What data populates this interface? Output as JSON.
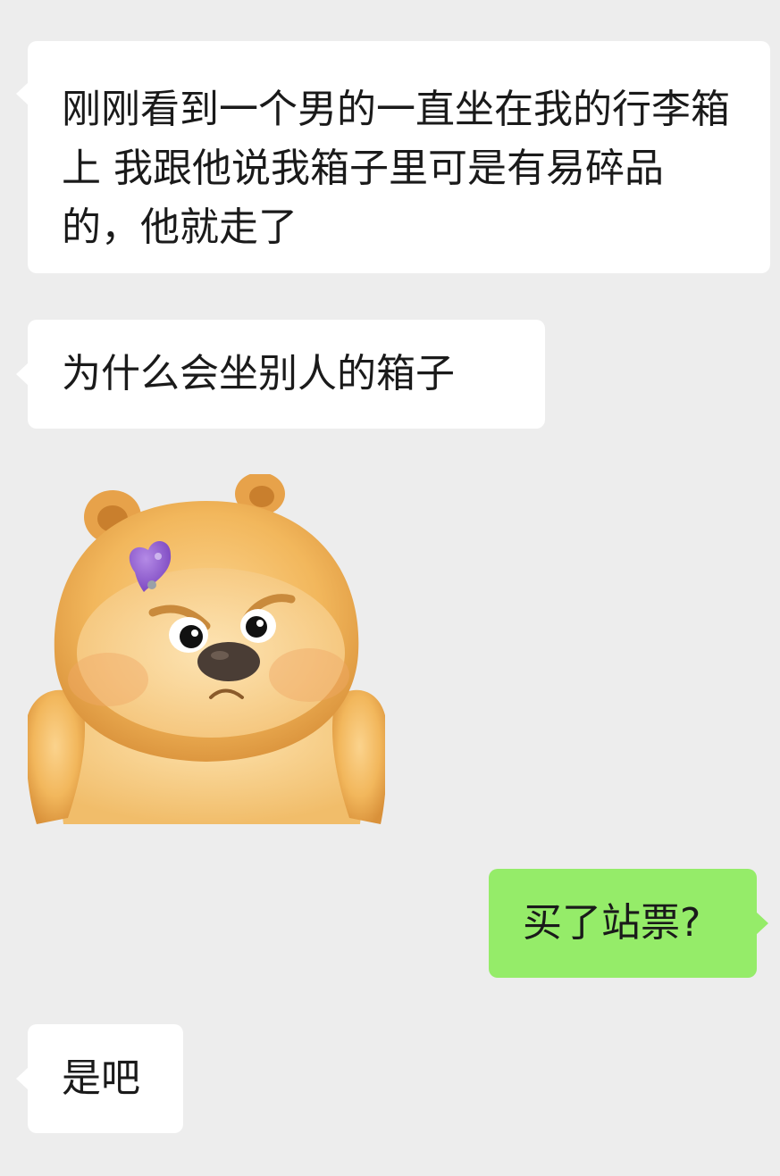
{
  "messages": [
    {
      "sender": "other",
      "text": "刚刚看到一个男的一直坐在我的行李箱上 我跟他说我箱子里可是有易碎品的，他就走了"
    },
    {
      "sender": "other",
      "text": "为什么会坐别人的箱子"
    },
    {
      "sender": "other",
      "sticker": "angry-hamster-sticker-icon"
    },
    {
      "sender": "me",
      "text": "买了站票?"
    },
    {
      "sender": "other",
      "text": "是吧"
    }
  ],
  "colors": {
    "background": "#ededed",
    "incoming_bubble": "#ffffff",
    "outgoing_bubble": "#95ec69",
    "text": "#1a1a1a",
    "sticker_fur": "#f0b357",
    "sticker_heart": "#8b58c9"
  }
}
